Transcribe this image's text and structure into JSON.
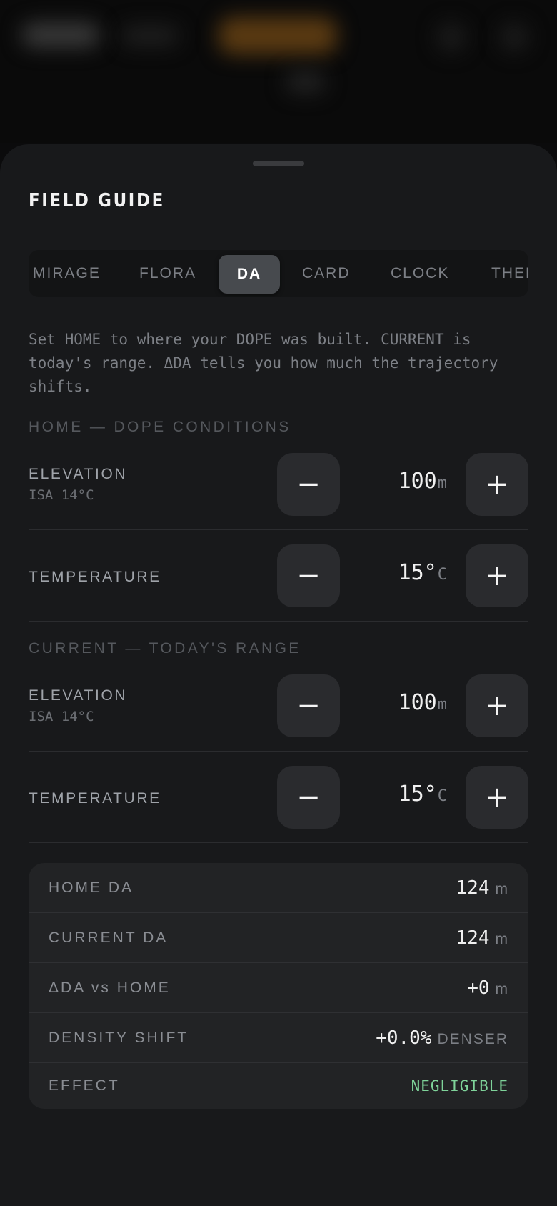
{
  "sheet": {
    "title": "FIELD GUIDE"
  },
  "tabs": [
    {
      "label": "MIRAGE",
      "active": false
    },
    {
      "label": "FLORA",
      "active": false
    },
    {
      "label": "DA",
      "active": true
    },
    {
      "label": "CARD",
      "active": false
    },
    {
      "label": "CLOCK",
      "active": false
    },
    {
      "label": "THERMAL",
      "active": false
    }
  ],
  "intro": "Set HOME to where your DOPE was built. CURRENT is today's range. ΔDA tells you how much the trajectory shifts.",
  "home": {
    "section_label": "HOME — DOPE CONDITIONS",
    "elevation": {
      "label": "ELEVATION",
      "sub": "ISA 14°C",
      "value": "100",
      "unit": "m"
    },
    "temperature": {
      "label": "TEMPERATURE",
      "value": "15°",
      "unit": "C"
    }
  },
  "current": {
    "section_label": "CURRENT — TODAY'S RANGE",
    "elevation": {
      "label": "ELEVATION",
      "sub": "ISA 14°C",
      "value": "100",
      "unit": "m"
    },
    "temperature": {
      "label": "TEMPERATURE",
      "value": "15°",
      "unit": "C"
    }
  },
  "controls": {
    "minus": "−",
    "plus": "+"
  },
  "results": {
    "home_da": {
      "label": "HOME DA",
      "value": "124",
      "unit": "m"
    },
    "current_da": {
      "label": "CURRENT DA",
      "value": "124",
      "unit": "m"
    },
    "delta_da": {
      "label": "ΔDA vs HOME",
      "value": "+0",
      "unit": "m"
    },
    "density_shift": {
      "label": "DENSITY SHIFT",
      "value": "+0.0%",
      "unit": "DENSER"
    },
    "effect": {
      "label": "EFFECT",
      "value": "NEGLIGIBLE"
    }
  },
  "colors": {
    "sheet_bg": "#18191b",
    "accent_effect": "#7fd39a",
    "button_bg": "#2a2b2e"
  }
}
